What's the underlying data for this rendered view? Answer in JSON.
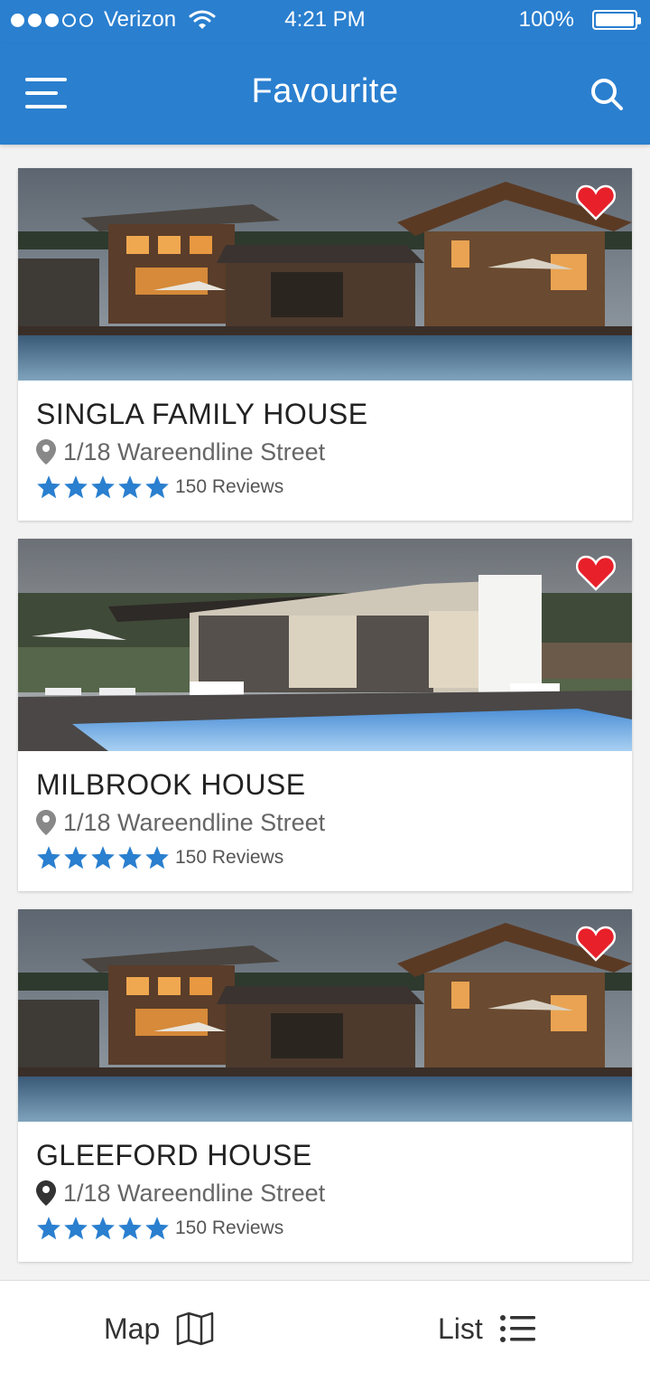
{
  "status_bar": {
    "carrier": "Verizon",
    "time": "4:21 PM",
    "battery": "100%",
    "signal_filled": 3,
    "signal_total": 5
  },
  "header": {
    "title": "Favourite",
    "menu_icon": "hamburger-menu-icon",
    "search_icon": "search-icon"
  },
  "colors": {
    "primary": "#2a7fcf",
    "favorite": "#e8202a",
    "star": "#2a7fcf"
  },
  "listings": [
    {
      "title": "SINGLA FAMILY HOUSE",
      "address": "1/18 Wareendline Street",
      "rating": 5,
      "reviews": "150 Reviews",
      "favorite": true,
      "image_alt": "Wooden lodge house with pool at dusk"
    },
    {
      "title": "MILBROOK HOUSE",
      "address": "1/18 Wareendline Street",
      "rating": 5,
      "reviews": "150 Reviews",
      "favorite": true,
      "image_alt": "Modern concrete house with pool"
    },
    {
      "title": "GLEEFORD HOUSE",
      "address": "1/18 Wareendline Street",
      "rating": 5,
      "reviews": "150 Reviews",
      "favorite": true,
      "image_alt": "Wooden lodge house with pool at dusk"
    }
  ],
  "bottom_bar": {
    "map_label": "Map",
    "map_icon": "map-icon",
    "list_label": "List",
    "list_icon": "list-icon"
  }
}
